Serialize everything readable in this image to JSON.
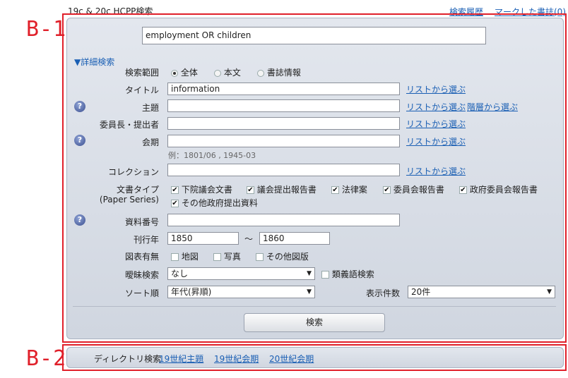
{
  "header": {
    "app_title": "19c & 20c HCPP検索",
    "history_link": "検索履歴",
    "marked_link": "マークした書誌(0)"
  },
  "annotations": {
    "b1": "B-1",
    "b2": "B-2"
  },
  "search": {
    "query": "employment OR children"
  },
  "advanced": {
    "toggle_label": "▼詳細検索",
    "scope": {
      "label": "検索範囲",
      "options": [
        "全体",
        "本文",
        "書誌情報"
      ],
      "selected": "全体"
    },
    "title": {
      "label": "タイトル",
      "value": "information",
      "list_link": "リストから選ぶ"
    },
    "subject": {
      "label": "主題",
      "value": "",
      "list_link": "リストから選ぶ",
      "hier_link": "階層から選ぶ"
    },
    "chair": {
      "label": "委員長・提出者",
      "value": "",
      "list_link": "リストから選ぶ"
    },
    "session": {
      "label": "会期",
      "value": "",
      "list_link": "リストから選ぶ",
      "hint": "例：1801/06 , 1945-03"
    },
    "collection": {
      "label": "コレクション",
      "value": "",
      "list_link": "リストから選ぶ"
    },
    "doctype": {
      "label": "文書タイプ",
      "sublabel": "(Paper Series)",
      "options": [
        "下院議会文書",
        "議会提出報告書",
        "法律案",
        "委員会報告書",
        "政府委員会報告書",
        "その他政府提出資料"
      ]
    },
    "docno": {
      "label": "資料番号",
      "value": ""
    },
    "year": {
      "label": "刊行年",
      "from": "1850",
      "tilde": "～",
      "to": "1860"
    },
    "figures": {
      "label": "図表有無",
      "options": [
        "地図",
        "写真",
        "その他図版"
      ]
    },
    "fuzzy": {
      "label": "曖昧検索",
      "value": "なし",
      "synonym": "類義語検索"
    },
    "sort": {
      "label": "ソート順",
      "value": "年代(昇順)"
    },
    "count": {
      "label": "表示件数",
      "value": "20件"
    },
    "search_button": "検索"
  },
  "directory": {
    "label": "ディレクトリ検索",
    "links": [
      "19世紀主題",
      "19世紀会期",
      "20世紀会期"
    ]
  },
  "icons": {
    "help": "help-icon",
    "dropdown": "chevron-down-icon"
  },
  "colors": {
    "annotation": "#e0202a",
    "link": "#1a5fb4"
  }
}
